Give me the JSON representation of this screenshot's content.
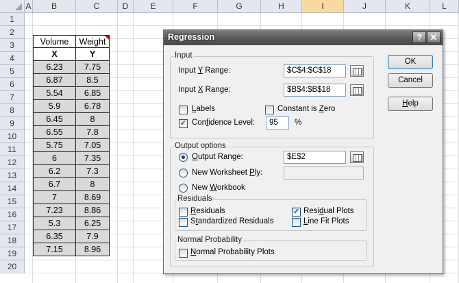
{
  "spreadsheet": {
    "columns": [
      "A",
      "B",
      "C",
      "D",
      "E",
      "F",
      "G",
      "H",
      "I",
      "J",
      "K",
      "L"
    ],
    "rows": [
      "1",
      "2",
      "3",
      "4",
      "5",
      "6",
      "7",
      "8",
      "9",
      "10",
      "11",
      "12",
      "13",
      "14",
      "15",
      "16",
      "17",
      "18",
      "19",
      "20"
    ],
    "table": {
      "headers": [
        "Volume",
        "Weight"
      ],
      "subheaders": [
        "X",
        "Y"
      ],
      "data": [
        [
          "6.23",
          "7.75"
        ],
        [
          "6.87",
          "8.5"
        ],
        [
          "5.54",
          "6.85"
        ],
        [
          "5.9",
          "6.78"
        ],
        [
          "6.45",
          "8"
        ],
        [
          "6.55",
          "7.8"
        ],
        [
          "5.75",
          "7.05"
        ],
        [
          "6",
          "7.35"
        ],
        [
          "6.2",
          "7.3"
        ],
        [
          "6.7",
          "8"
        ],
        [
          "7",
          "8.69"
        ],
        [
          "7.23",
          "8.86"
        ],
        [
          "5.3",
          "6.25"
        ],
        [
          "6.35",
          "7.9"
        ],
        [
          "7.15",
          "8.96"
        ]
      ]
    }
  },
  "dialog": {
    "title": "Regression",
    "help_glyph": "?",
    "close_glyph": "✕",
    "input": {
      "group_label": "Input",
      "y_range_label": "Input Y Range:",
      "y_range_value": "$C$4:$C$18",
      "x_range_label": "Input X Range:",
      "x_range_value": "$B$4:$B$18",
      "labels_label": "Labels",
      "labels_checked": false,
      "constant_zero_label": "Constant is Zero",
      "constant_zero_checked": false,
      "confidence_label": "Confidence Level:",
      "confidence_checked": true,
      "confidence_value": "95",
      "percent_label": "%"
    },
    "output": {
      "group_label": "Output options",
      "output_range_label": "Output Range:",
      "output_range_value": "$E$2",
      "new_ply_label": "New Worksheet Ply:",
      "new_ply_value": "",
      "new_workbook_label": "New Workbook",
      "selected": "output_range"
    },
    "residuals": {
      "group_label": "Residuals",
      "residuals_label": "Residuals",
      "residuals_checked": false,
      "residual_plots_label": "Residual Plots",
      "residual_plots_checked": true,
      "standardized_label": "Standardized Residuals",
      "standardized_checked": false,
      "line_fit_label": "Line Fit Plots",
      "line_fit_checked": false
    },
    "normal": {
      "group_label": "Normal Probability",
      "plots_label": "Normal Probability Plots",
      "plots_checked": false
    },
    "buttons": {
      "ok": "OK",
      "cancel": "Cancel",
      "help": "Help"
    },
    "check_glyph": "✓"
  },
  "colors": {
    "title_bar": "#5a5a5a",
    "table_fill": "#d9d9d9",
    "selected_header": "#f9d99f",
    "close_button": "#7d7d7d"
  },
  "icons": [
    "range-selector-icon",
    "help-icon",
    "close-icon",
    "comment-indicator-icon"
  ]
}
